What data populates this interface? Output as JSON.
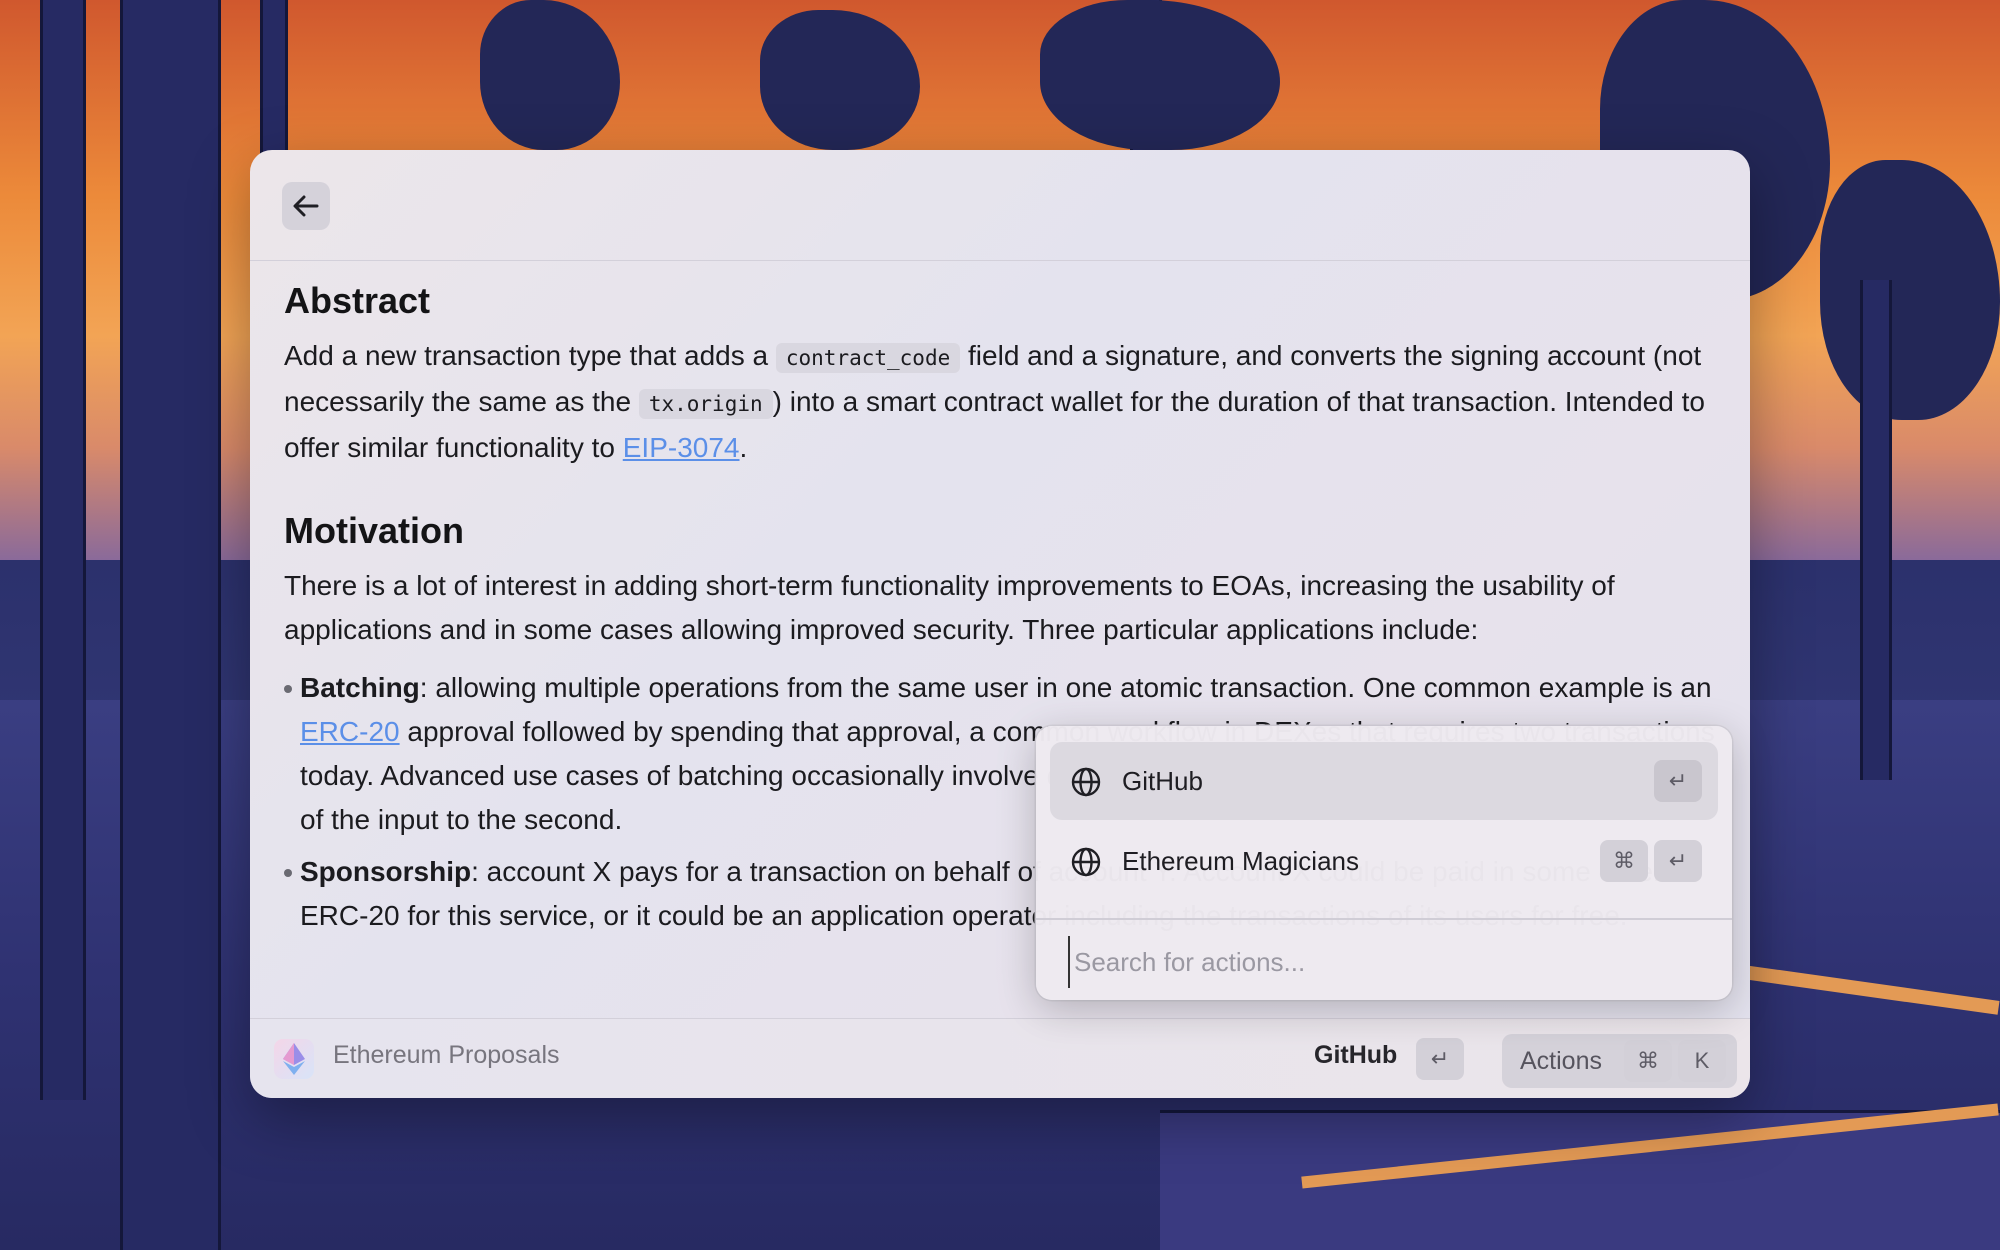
{
  "colors": {
    "accent_link": "#5b8fe8",
    "window_bg": "#e6e3ec",
    "text": "#1b1b1f"
  },
  "header": {
    "back_icon": "arrow-left-icon"
  },
  "content": {
    "abstract": {
      "heading": "Abstract",
      "p1": "Add a new transaction type that adds a",
      "code1": "contract_code",
      "p2": "field and a signature, and converts the signing account (not necessarily the same as the",
      "code2": "tx.origin",
      "p3": ") into a smart contract wallet for the duration of that transaction. Intended to offer similar functionality to",
      "link": "EIP-3074",
      "p4": "."
    },
    "motivation": {
      "heading": "Motivation",
      "intro": "There is a lot of interest in adding short-term functionality improvements to EOAs, increasing the usability of applications and in some cases allowing improved security. Three particular applications include:",
      "items": [
        {
          "term": "Batching",
          "text_a": ": allowing multiple operations from the same user in one atomic transaction. One common example is an",
          "link": "ERC-20",
          "text_b": "approval followed by spending that approval, a common workflow in DEXes that requires two transactions today. Advanced use cases of batching occasionally involve dependencies: the output of the first operation is part of the input to the second."
        },
        {
          "term": "Sponsorship",
          "text": ": account X pays for a transaction on behalf of account Y. Account X could be paid in some other ERC-20 for this service, or it could be an application operator including the transactions of its users for free."
        }
      ]
    }
  },
  "footer": {
    "app_name": "Ethereum Proposals",
    "primary_action": "GitHub",
    "enter_key": "↵",
    "actions_label": "Actions",
    "cmd_key": "⌘",
    "k_key": "K"
  },
  "menu": {
    "items": [
      {
        "label": "GitHub",
        "icon": "globe-icon",
        "shortcut": [
          "↵"
        ]
      },
      {
        "label": "Ethereum Magicians",
        "icon": "globe-icon",
        "shortcut": [
          "⌘",
          "↵"
        ]
      }
    ],
    "search_placeholder": "Search for actions..."
  }
}
